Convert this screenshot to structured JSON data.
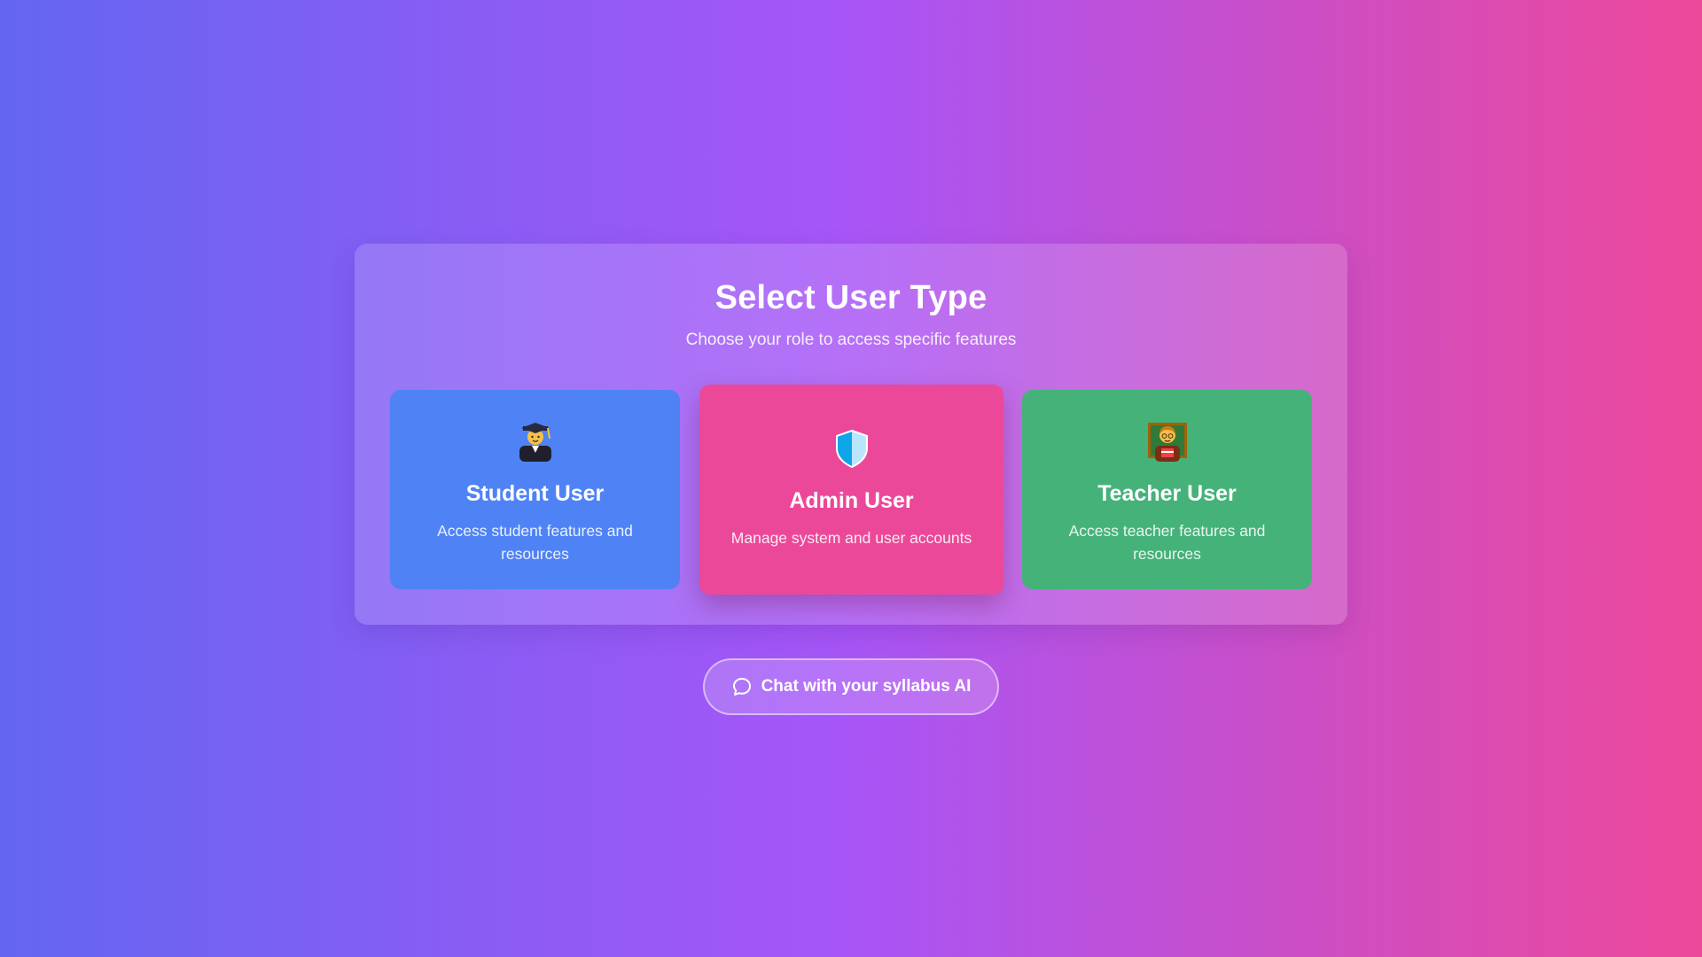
{
  "header": {
    "title": "Select User Type",
    "subtitle": "Choose your role to access specific features"
  },
  "cards": [
    {
      "title": "Student User",
      "description": "Access student features and resources",
      "icon": "student-graduate-icon",
      "color": "#4f83f5"
    },
    {
      "title": "Admin User",
      "description": "Manage system and user accounts",
      "icon": "shield-icon",
      "color": "#ec4899"
    },
    {
      "title": "Teacher User",
      "description": "Access teacher features and resources",
      "icon": "teacher-icon",
      "color": "#45b27a"
    }
  ],
  "chat_button": {
    "label": "Chat with your syllabus AI",
    "icon": "chat-bubble-icon"
  },
  "colors": {
    "background_gradient": [
      "#6366f1",
      "#a855f7",
      "#ec4899"
    ]
  }
}
